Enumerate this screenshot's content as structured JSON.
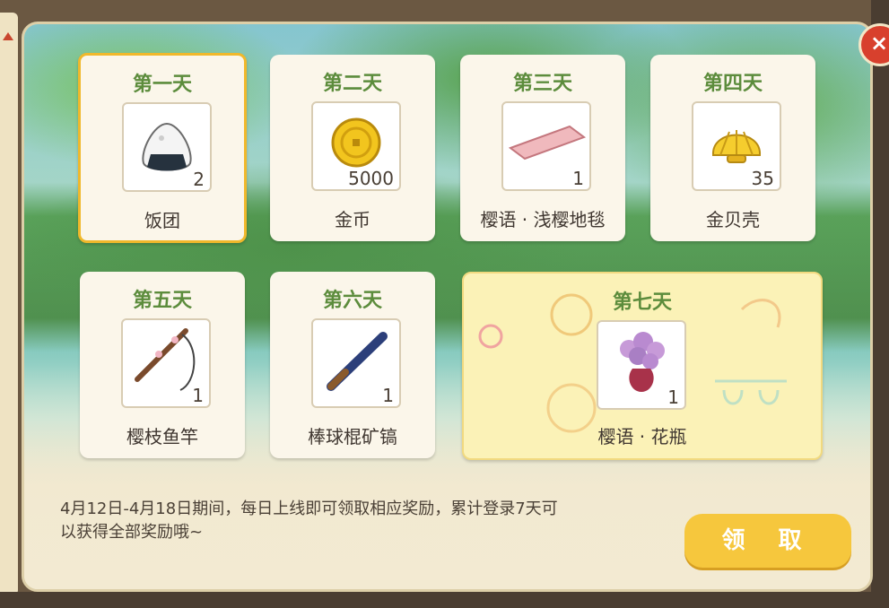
{
  "rewards": [
    {
      "day": "第一天",
      "name": "饭团",
      "qty": "2",
      "icon": "rice-ball-icon"
    },
    {
      "day": "第二天",
      "name": "金币",
      "qty": "5000",
      "icon": "gold-coin-icon"
    },
    {
      "day": "第三天",
      "name": "樱语 · 浅樱地毯",
      "qty": "1",
      "icon": "pink-rug-icon"
    },
    {
      "day": "第四天",
      "name": "金贝壳",
      "qty": "35",
      "icon": "golden-shell-icon"
    },
    {
      "day": "第五天",
      "name": "樱枝鱼竿",
      "qty": "1",
      "icon": "fishing-rod-icon"
    },
    {
      "day": "第六天",
      "name": "棒球棍矿镐",
      "qty": "1",
      "icon": "baseball-bat-pickaxe-icon"
    },
    {
      "day": "第七天",
      "name": "樱语 · 花瓶",
      "qty": "1",
      "icon": "flower-vase-icon"
    }
  ],
  "description": "4月12日-4月18日期间，每日上线即可领取相应奖励，累计登录7天可以获得全部奖励哦~",
  "claim_label": "领 取",
  "selected_day": 1,
  "colors": {
    "day_text": "#5c8c3c",
    "accent": "#f6c73d",
    "selected_border": "#f0b82b"
  }
}
